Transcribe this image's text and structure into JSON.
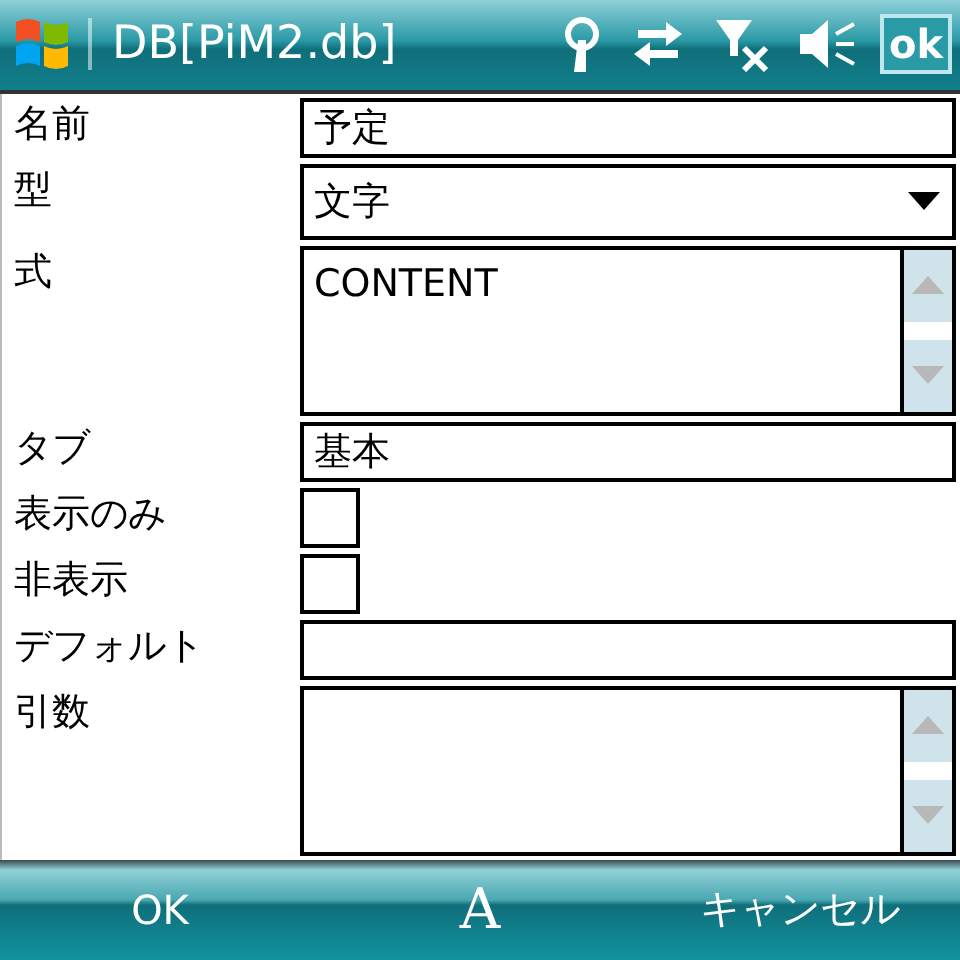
{
  "window": {
    "title": "DB[PiM2.db]",
    "ok_button": "ok"
  },
  "fields": [
    {
      "label": "名前",
      "kind": "text",
      "value": "予定"
    },
    {
      "label": "型",
      "kind": "select",
      "value": "文字"
    },
    {
      "label": "式",
      "kind": "textarea",
      "value": "CONTENT"
    },
    {
      "label": "タブ",
      "kind": "text",
      "value": "基本"
    },
    {
      "label": "表示のみ",
      "kind": "checkbox",
      "checked": false
    },
    {
      "label": "非表示",
      "kind": "checkbox",
      "checked": false
    },
    {
      "label": "デフォルト",
      "kind": "text"
    },
    {
      "label": "引数",
      "kind": "textarea"
    }
  ],
  "softkeys": {
    "left": "OK",
    "input_mode": "A",
    "right": "キャンセル"
  }
}
